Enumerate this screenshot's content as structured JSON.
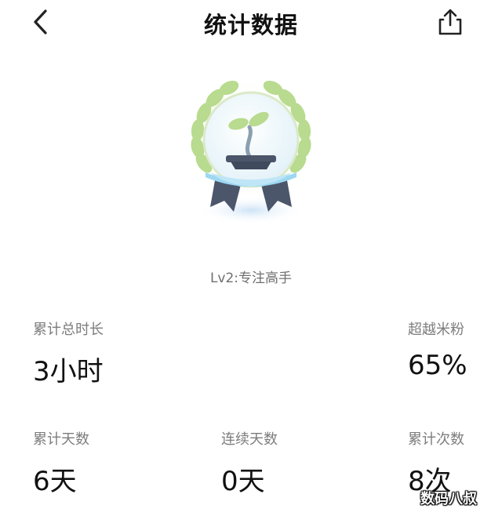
{
  "header": {
    "title": "统计数据",
    "back_icon": "chevron-left-icon",
    "share_icon": "share-icon"
  },
  "badge": {
    "level": "Lv2:专注高手",
    "icon": "sprout-pot-badge-icon"
  },
  "stats": [
    {
      "label": "累计总时长",
      "value": "3小时"
    },
    {
      "label": "超越米粉",
      "value": "65%"
    },
    {
      "label": "累计天数",
      "value": "6天"
    },
    {
      "label": "连续天数",
      "value": "0天"
    },
    {
      "label": "累计次数",
      "value": "8次"
    }
  ],
  "watermark": "数码八叔",
  "colors": {
    "text_primary": "#111111",
    "text_secondary": "#7d7d7d",
    "laurel": "#b5d98a",
    "medal_ribbon": "#4b566b",
    "water": "#9dd7f2"
  }
}
